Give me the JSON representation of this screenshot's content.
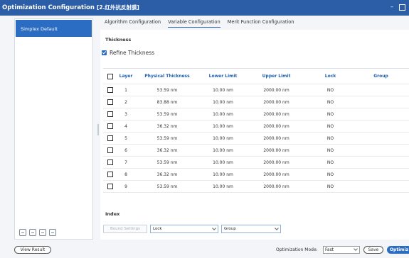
{
  "window": {
    "title": "Optimization Configuration",
    "subtitle": "[2.红外抗反射膜]",
    "minimize_glyph": "–"
  },
  "sidebar": {
    "items": [
      {
        "label": "Simplex Default",
        "selected": true
      }
    ],
    "tool_icons": [
      "add-icon",
      "copy-icon",
      "delete-icon",
      "export-icon"
    ]
  },
  "tabs": [
    {
      "label": "Algorithm Configuration",
      "active": false
    },
    {
      "label": "Variable Configuration",
      "active": true
    },
    {
      "label": "Merit Function Configuration",
      "active": false
    }
  ],
  "thickness": {
    "section_title": "Thickness",
    "refine_label": "Refine Thickness",
    "refine_checked": true
  },
  "table": {
    "headers": {
      "layer": "Layer",
      "physical": "Physical Thickness",
      "lower": "Lower Limit",
      "upper": "Upper Limit",
      "lock": "Lock",
      "group": "Group"
    },
    "rows": [
      {
        "layer": "1",
        "physical": "53.59 nm",
        "lower": "10.00 nm",
        "upper": "2000.00 nm",
        "lock": "NO",
        "group": ""
      },
      {
        "layer": "2",
        "physical": "83.88 nm",
        "lower": "10.00 nm",
        "upper": "2000.00 nm",
        "lock": "NO",
        "group": ""
      },
      {
        "layer": "3",
        "physical": "53.59 nm",
        "lower": "10.00 nm",
        "upper": "2000.00 nm",
        "lock": "NO",
        "group": ""
      },
      {
        "layer": "4",
        "physical": "36.32 nm",
        "lower": "10.00 nm",
        "upper": "2000.00 nm",
        "lock": "NO",
        "group": ""
      },
      {
        "layer": "5",
        "physical": "53.59 nm",
        "lower": "10.00 nm",
        "upper": "2000.00 nm",
        "lock": "NO",
        "group": ""
      },
      {
        "layer": "6",
        "physical": "36.32 nm",
        "lower": "10.00 nm",
        "upper": "2000.00 nm",
        "lock": "NO",
        "group": ""
      },
      {
        "layer": "7",
        "physical": "53.59 nm",
        "lower": "10.00 nm",
        "upper": "2000.00 nm",
        "lock": "NO",
        "group": ""
      },
      {
        "layer": "8",
        "physical": "36.32 nm",
        "lower": "10.00 nm",
        "upper": "2000.00 nm",
        "lock": "NO",
        "group": ""
      },
      {
        "layer": "9",
        "physical": "53.59 nm",
        "lower": "10.00 nm",
        "upper": "2000.00 nm",
        "lock": "NO",
        "group": ""
      }
    ]
  },
  "controls": {
    "bound_settings": "Bound Settings",
    "lock_dropdown": "Lock",
    "group_dropdown": "Group"
  },
  "index": {
    "section_title": "Index"
  },
  "footer": {
    "view_result": "View Result",
    "mode_label": "Optimization Mode:",
    "mode_value": "Fast",
    "save": "Save",
    "optimize": "Optimiz"
  }
}
